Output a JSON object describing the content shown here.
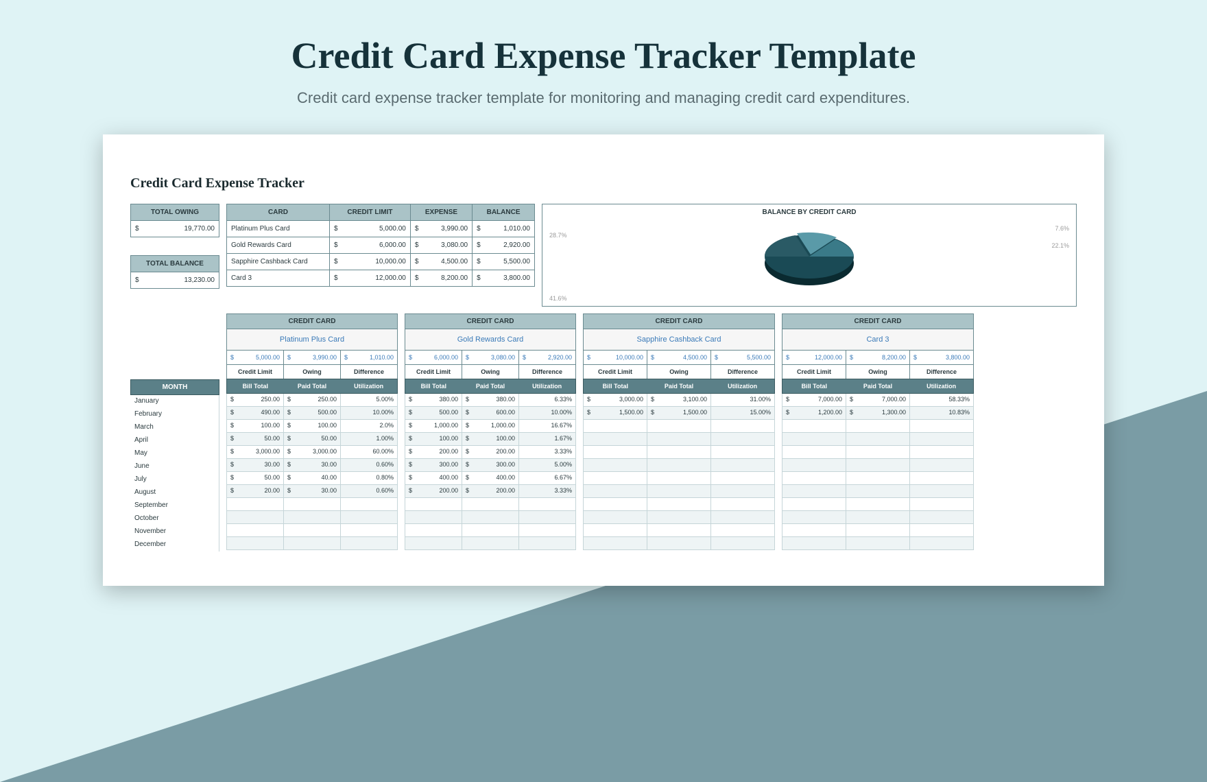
{
  "header": {
    "title": "Credit Card Expense Tracker Template",
    "subtitle": "Credit card expense tracker template for monitoring and managing credit card expenditures."
  },
  "sheet_title": "Credit Card Expense Tracker",
  "totals": {
    "owing_label": "TOTAL OWING",
    "owing_value": "19,770.00",
    "balance_label": "TOTAL BALANCE",
    "balance_value": "13,230.00"
  },
  "summary": {
    "headers": {
      "card": "CARD",
      "limit": "CREDIT LIMIT",
      "expense": "EXPENSE",
      "balance": "BALANCE"
    },
    "rows": [
      {
        "card": "Platinum Plus Card",
        "limit": "5,000.00",
        "expense": "3,990.00",
        "balance": "1,010.00"
      },
      {
        "card": "Gold Rewards Card",
        "limit": "6,000.00",
        "expense": "3,080.00",
        "balance": "2,920.00"
      },
      {
        "card": "Sapphire Cashback Card",
        "limit": "10,000.00",
        "expense": "4,500.00",
        "balance": "5,500.00"
      },
      {
        "card": "Card 3",
        "limit": "12,000.00",
        "expense": "8,200.00",
        "balance": "3,800.00"
      }
    ]
  },
  "chart_data": {
    "type": "pie",
    "title": "BALANCE BY CREDIT CARD",
    "series": [
      {
        "name": "Platinum Plus Card",
        "value": 1010,
        "pct": "7.6%"
      },
      {
        "name": "Gold Rewards Card",
        "value": 2920,
        "pct": "22.1%"
      },
      {
        "name": "Sapphire Cashback Card",
        "value": 5500,
        "pct": "41.6%"
      },
      {
        "name": "Card 3",
        "value": 3800,
        "pct": "28.7%"
      }
    ]
  },
  "months_label": "MONTH",
  "months": [
    "January",
    "February",
    "March",
    "April",
    "May",
    "June",
    "July",
    "August",
    "September",
    "October",
    "November",
    "December"
  ],
  "card_common": {
    "header": "CREDIT CARD",
    "sub_limit": "Credit Limit",
    "sub_owing": "Owing",
    "sub_diff": "Difference",
    "col_bill": "Bill Total",
    "col_paid": "Paid Total",
    "col_util": "Utilization"
  },
  "cards": [
    {
      "name": "Platinum Plus Card",
      "limit": "5,000.00",
      "owing": "3,990.00",
      "diff": "1,010.00",
      "rows": [
        {
          "bill": "250.00",
          "paid": "250.00",
          "util": "5.00%"
        },
        {
          "bill": "490.00",
          "paid": "500.00",
          "util": "10.00%"
        },
        {
          "bill": "100.00",
          "paid": "100.00",
          "util": "2.0%"
        },
        {
          "bill": "50.00",
          "paid": "50.00",
          "util": "1.00%"
        },
        {
          "bill": "3,000.00",
          "paid": "3,000.00",
          "util": "60.00%"
        },
        {
          "bill": "30.00",
          "paid": "30.00",
          "util": "0.60%"
        },
        {
          "bill": "50.00",
          "paid": "40.00",
          "util": "0.80%"
        },
        {
          "bill": "20.00",
          "paid": "30.00",
          "util": "0.60%"
        }
      ]
    },
    {
      "name": "Gold Rewards Card",
      "limit": "6,000.00",
      "owing": "3,080.00",
      "diff": "2,920.00",
      "rows": [
        {
          "bill": "380.00",
          "paid": "380.00",
          "util": "6.33%"
        },
        {
          "bill": "500.00",
          "paid": "600.00",
          "util": "10.00%"
        },
        {
          "bill": "1,000.00",
          "paid": "1,000.00",
          "util": "16.67%"
        },
        {
          "bill": "100.00",
          "paid": "100.00",
          "util": "1.67%"
        },
        {
          "bill": "200.00",
          "paid": "200.00",
          "util": "3.33%"
        },
        {
          "bill": "300.00",
          "paid": "300.00",
          "util": "5.00%"
        },
        {
          "bill": "400.00",
          "paid": "400.00",
          "util": "6.67%"
        },
        {
          "bill": "200.00",
          "paid": "200.00",
          "util": "3.33%"
        }
      ]
    },
    {
      "name": "Sapphire Cashback Card",
      "limit": "10,000.00",
      "owing": "4,500.00",
      "diff": "5,500.00",
      "rows": [
        {
          "bill": "3,000.00",
          "paid": "3,100.00",
          "util": "31.00%"
        },
        {
          "bill": "1,500.00",
          "paid": "1,500.00",
          "util": "15.00%"
        }
      ]
    },
    {
      "name": "Card 3",
      "limit": "12,000.00",
      "owing": "8,200.00",
      "diff": "3,800.00",
      "rows": [
        {
          "bill": "7,000.00",
          "paid": "7,000.00",
          "util": "58.33%"
        },
        {
          "bill": "1,200.00",
          "paid": "1,300.00",
          "util": "10.83%"
        }
      ]
    }
  ]
}
